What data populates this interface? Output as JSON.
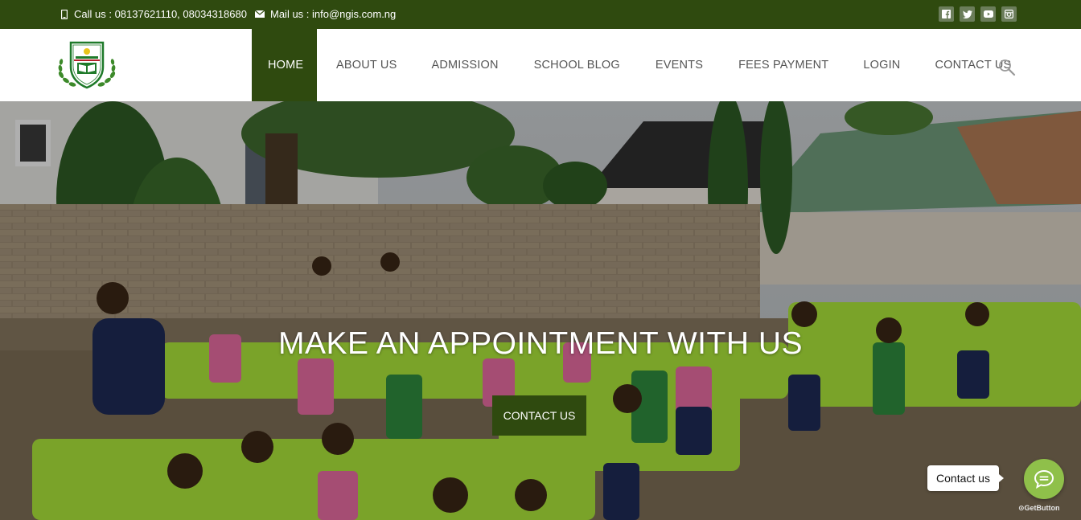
{
  "topbar": {
    "call_text": "Call us : 08137621110, 08034318680",
    "mail_text": "Mail us : info@ngis.com.ng",
    "social": [
      "facebook-icon",
      "twitter-icon",
      "youtube-icon",
      "instagram-icon"
    ]
  },
  "nav": {
    "items": [
      {
        "label": "HOME",
        "active": true
      },
      {
        "label": "ABOUT US"
      },
      {
        "label": "ADMISSION"
      },
      {
        "label": "SCHOOL BLOG"
      },
      {
        "label": "EVENTS"
      },
      {
        "label": "FEES PAYMENT"
      },
      {
        "label": "LOGIN"
      },
      {
        "label": "CONTACT US"
      }
    ]
  },
  "hero": {
    "title": "MAKE AN APPOINTMENT WITH US",
    "button_label": "CONTACT US"
  },
  "widget": {
    "bubble_text": "Contact us",
    "brand": "GetButton"
  },
  "colors": {
    "brand_green": "#2f4a0f",
    "widget_green": "#8fc04a"
  }
}
